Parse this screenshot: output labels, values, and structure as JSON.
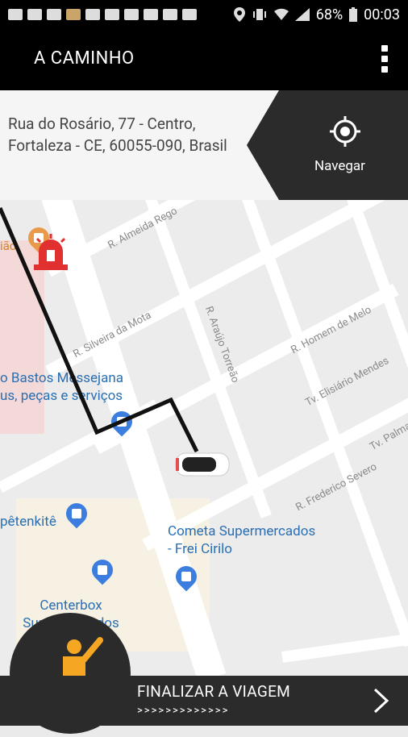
{
  "status_bar": {
    "battery": "68%",
    "time": "00:03"
  },
  "app_bar": {
    "title": "A CAMINHO"
  },
  "address": {
    "text": "Rua do Rosário, 77 - Centro, Fortaleza - CE, 60055-090, Brasil"
  },
  "navigate": {
    "label": "Navegar"
  },
  "map": {
    "streets": [
      "R. Almeida Rego",
      "R. Silveira da Mota",
      "R. Araújo Torreão",
      "R. Homem de Melo",
      "Tv. Elisiário Mendes",
      "R. Frederico Severo",
      "Tv. Palma"
    ],
    "pois": {
      "bastos": "o Bastos Messejana\nus, peças e serviços",
      "cometa": "Cometa Supermercados\n- Frei Cirilo",
      "centerbox": "Centerbox\nSupermercados",
      "petenkite": "pêtenkitê",
      "iao": "ião"
    }
  },
  "bottom": {
    "title": "FINALIZAR A VIAGEM",
    "arrows": ">>>>>>>>>>>>>"
  }
}
